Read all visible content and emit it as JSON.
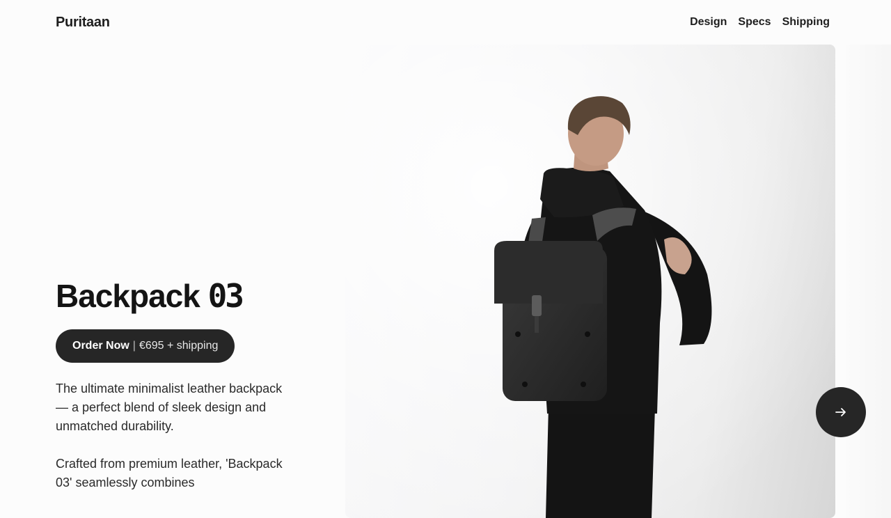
{
  "header": {
    "brand": "Puritaan",
    "nav": [
      "Design",
      "Specs",
      "Shipping"
    ]
  },
  "hero": {
    "title_text": "Backpack ",
    "title_number": "03",
    "order_label": "Order Now",
    "order_separator": "|",
    "order_price": "€695 + shipping",
    "paragraphs": [
      "The ultimate minimalist leather backpack — a perfect blend of sleek design and unmatched durability.",
      "Crafted from premium leather, 'Backpack 03' seamlessly combines"
    ]
  },
  "gallery": {
    "image_subject": "person-wearing-black-leather-backpack",
    "next_icon": "arrow-right-icon"
  },
  "colors": {
    "button_bg": "#262626",
    "button_text": "#ffffff",
    "text": "#1a1a1a"
  }
}
